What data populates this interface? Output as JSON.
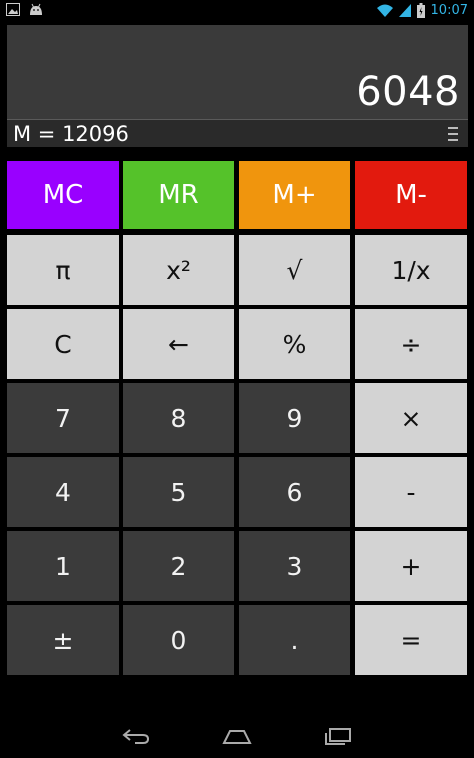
{
  "status_bar": {
    "time": "10:07",
    "icons": [
      "image-notification-icon",
      "android-notification-icon",
      "wifi-icon",
      "signal-icon",
      "battery-icon"
    ]
  },
  "display": {
    "value": "6048",
    "memory_text": "M = 12096",
    "menu_icon": "overflow-menu-icon"
  },
  "memory_keys": [
    {
      "label": "MC",
      "color": "#9900ff"
    },
    {
      "label": "MR",
      "color": "#55c22a"
    },
    {
      "label": "M+",
      "color": "#f0950d"
    },
    {
      "label": "M-",
      "color": "#e21a0e"
    }
  ],
  "keys": {
    "row1": [
      "π",
      "x²",
      "√",
      "1/x"
    ],
    "row2": [
      "C",
      "←",
      "%",
      "÷"
    ],
    "row3": [
      "7",
      "8",
      "9",
      "×"
    ],
    "row4": [
      "4",
      "5",
      "6",
      "-"
    ],
    "row5": [
      "1",
      "2",
      "3",
      "+"
    ],
    "row6": [
      "±",
      "0",
      ".",
      "="
    ]
  },
  "colors": {
    "function_key_bg": "#d3d3d3",
    "digit_key_bg": "#3b3b3b",
    "status_accent": "#33b5e5"
  },
  "nav_bar": {
    "icons": [
      "back-icon",
      "home-icon",
      "recents-icon"
    ]
  }
}
